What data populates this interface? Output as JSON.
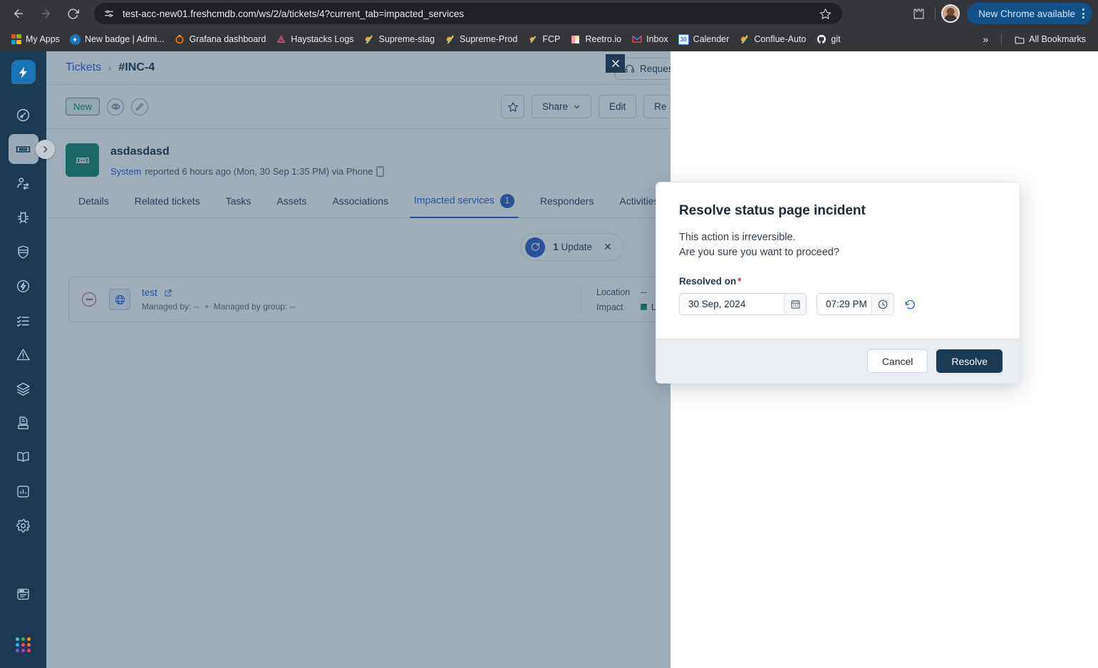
{
  "browser": {
    "url": "test-acc-new01.freshcmdb.com/ws/2/a/tickets/4?current_tab=impacted_services",
    "back_icon": "back-arrow-icon",
    "forward_icon": "forward-arrow-icon",
    "reload_icon": "reload-icon",
    "site_settings_icon": "site-settings-icon",
    "bookmark_star_icon": "bookmark-star-icon",
    "extensions_icon": "extensions-puzzle-icon",
    "update_pill": "New Chrome available",
    "bookmarks": [
      {
        "label": "My Apps",
        "icon": "microsoft-grid-icon"
      },
      {
        "label": "New badge | Admi...",
        "icon": "freshworks-bolt-icon"
      },
      {
        "label": "Grafana dashboard",
        "icon": "grafana-icon"
      },
      {
        "label": "Haystacks Logs",
        "icon": "sentry-icon"
      },
      {
        "label": "Supreme-stag",
        "icon": "prism-icon"
      },
      {
        "label": "Supreme-Prod",
        "icon": "prism-icon"
      },
      {
        "label": "FCP",
        "icon": "prism-icon"
      },
      {
        "label": "Reetro.io",
        "icon": "reetro-icon"
      },
      {
        "label": "Inbox",
        "icon": "gmail-icon"
      },
      {
        "label": "Calender",
        "icon": "google-calendar-icon"
      },
      {
        "label": "Confluе-Auto",
        "icon": "prism-icon"
      },
      {
        "label": "git",
        "icon": "github-icon"
      }
    ],
    "overflow_label": "»",
    "all_bookmarks": "All Bookmarks"
  },
  "rail": {
    "logo_icon": "freshworks-bolt-logo",
    "toggle_icon": "chevron-right-icon",
    "items": [
      {
        "name": "dashboard",
        "icon": "speedometer-icon",
        "active": false,
        "dots": false
      },
      {
        "name": "tickets",
        "icon": "ticket-icon",
        "active": true,
        "dots": true
      },
      {
        "name": "requesters",
        "icon": "user-switch-icon",
        "active": false,
        "dots": true
      },
      {
        "name": "problems",
        "icon": "bug-icon",
        "active": false,
        "dots": false
      },
      {
        "name": "changes",
        "icon": "shield-icon",
        "active": false,
        "dots": false
      },
      {
        "name": "releases",
        "icon": "bolt-circle-icon",
        "active": false,
        "dots": false
      },
      {
        "name": "tasks",
        "icon": "checklist-icon",
        "active": false,
        "dots": false
      },
      {
        "name": "alerts",
        "icon": "warning-triangle-icon",
        "active": false,
        "dots": true
      },
      {
        "name": "assets",
        "icon": "layers-icon",
        "active": false,
        "dots": true
      },
      {
        "name": "contracts",
        "icon": "archive-doc-icon",
        "active": false,
        "dots": true
      },
      {
        "name": "solutions",
        "icon": "book-icon",
        "active": false,
        "dots": false
      },
      {
        "name": "analytics",
        "icon": "bar-chart-icon",
        "active": false,
        "dots": true
      },
      {
        "name": "admin",
        "icon": "gear-icon",
        "active": false,
        "dots": false
      },
      {
        "name": "status-page",
        "icon": "browser-window-icon",
        "active": false,
        "dots": false
      }
    ],
    "apps_icon": "app-switcher-dots-icon"
  },
  "breadcrumb": {
    "parent": "Tickets",
    "separator": "›",
    "current": "#INC-4"
  },
  "header": {
    "requester_button": "Reques",
    "requester_icon": "headset-icon"
  },
  "action_bar": {
    "status": "New",
    "watch_icon": "eye-icon",
    "edit_pencil_icon": "pencil-icon",
    "star_icon": "star-outline-icon",
    "share_label": "Share",
    "share_caret_icon": "chevron-down-icon",
    "edit_label": "Edit",
    "reply_label": "Re"
  },
  "ticket": {
    "avatar_icon": "ticket-avatar-icon",
    "subject": "asdasdasd",
    "reporter": "System",
    "meta": "reported 6 hours ago (Mon, 30 Sep 1:35 PM) via Phone",
    "channel_icon": "phone-icon"
  },
  "tabs": [
    {
      "label": "Details",
      "active": false,
      "badge": null
    },
    {
      "label": "Related tickets",
      "active": false,
      "badge": null
    },
    {
      "label": "Tasks",
      "active": false,
      "badge": null
    },
    {
      "label": "Assets",
      "active": false,
      "badge": null
    },
    {
      "label": "Associations",
      "active": false,
      "badge": null
    },
    {
      "label": "Impacted services",
      "active": true,
      "badge": "1"
    },
    {
      "label": "Responders",
      "active": false,
      "badge": null
    },
    {
      "label": "Activities",
      "active": false,
      "badge": null
    }
  ],
  "update_pill": {
    "icon": "refresh-circle-icon",
    "count": "1",
    "label": "Update",
    "close_icon": "close-x-icon"
  },
  "service_row": {
    "remove_icon": "minus-circle-icon",
    "type_icon": "globe-icon",
    "name": "test",
    "external_link_icon": "external-link-icon",
    "managed_by": "Managed by: --",
    "managed_by_group": "Managed by group: --",
    "location_label": "Location",
    "location_value": "--",
    "impact_label": "Impact",
    "impact_value": "Low",
    "impact_color": "#12866b"
  },
  "overlay": {
    "close_icon": "close-x-icon"
  },
  "modal": {
    "title": "Resolve status page incident",
    "line1": "This action is irreversible.",
    "line2": "Are you sure you want to proceed?",
    "field_label": "Resolved on",
    "required_marker": "*",
    "date_value": "30 Sep, 2024",
    "date_picker_icon": "calendar-icon",
    "time_value": "07:29 PM",
    "time_picker_icon": "clock-icon",
    "reset_icon": "reset-undo-icon",
    "cancel_label": "Cancel",
    "resolve_label": "Resolve",
    "accent_color": "#1d3a53"
  }
}
